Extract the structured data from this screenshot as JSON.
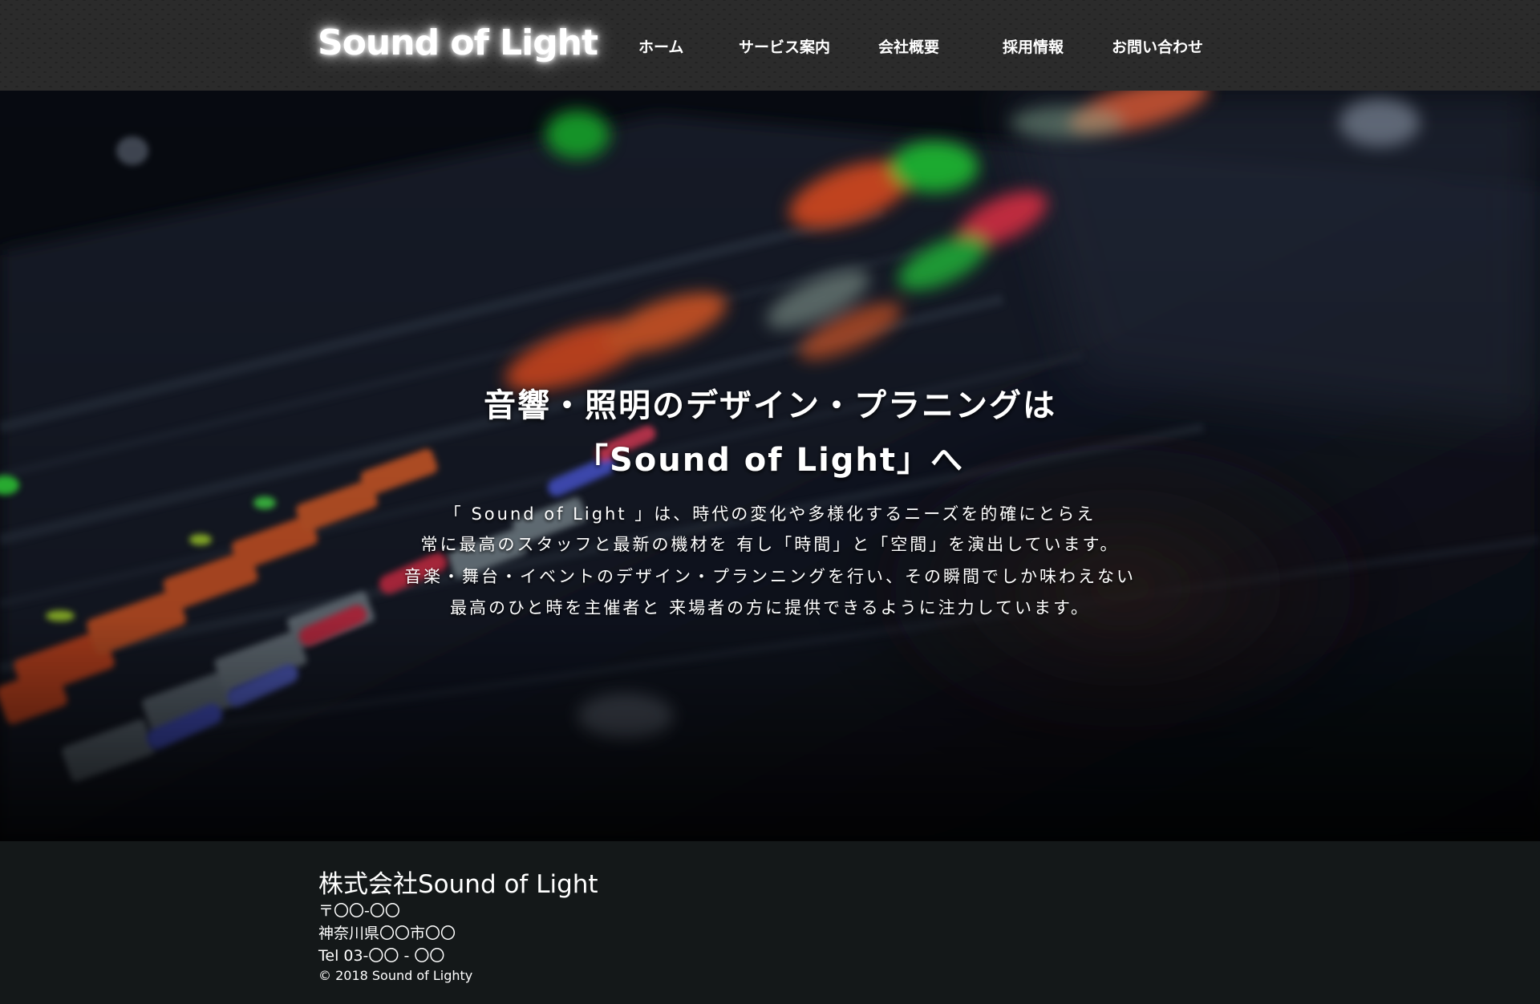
{
  "header": {
    "logo": "Sound of Light",
    "nav": [
      {
        "label": "ホーム"
      },
      {
        "label": "サービス案内"
      },
      {
        "label": "会社概要"
      },
      {
        "label": "採用情報"
      },
      {
        "label": "お問い合わせ"
      }
    ]
  },
  "hero": {
    "headline_1": "音響・照明のデザイン・プラニングは",
    "headline_2": "「Sound of Light」へ",
    "body": [
      "「 Sound of Light 」は、時代の変化や多様化するニーズを的確にとらえ",
      "常に最高のスタッフと最新の機材を 有し「時間」と「空間」を演出しています。",
      "音楽・舞台・イベントのデザイン・プランニングを行い、その瞬間でしか味わえない",
      "最高のひと時を主催者と 来場者の方に提供できるように注力しています。"
    ],
    "background": "audio-mixing-console-photo"
  },
  "footer": {
    "company": "株式会社Sound of Light",
    "postal": "〒〇〇-〇〇",
    "address": "神奈川県〇〇市〇〇",
    "tel": "Tel 03-〇〇 - 〇〇",
    "copyright": "© 2018 Sound of Lighty"
  },
  "colors": {
    "header_bg": "#1c1c1c",
    "footer_bg": "#141819",
    "text": "#ffffff"
  }
}
